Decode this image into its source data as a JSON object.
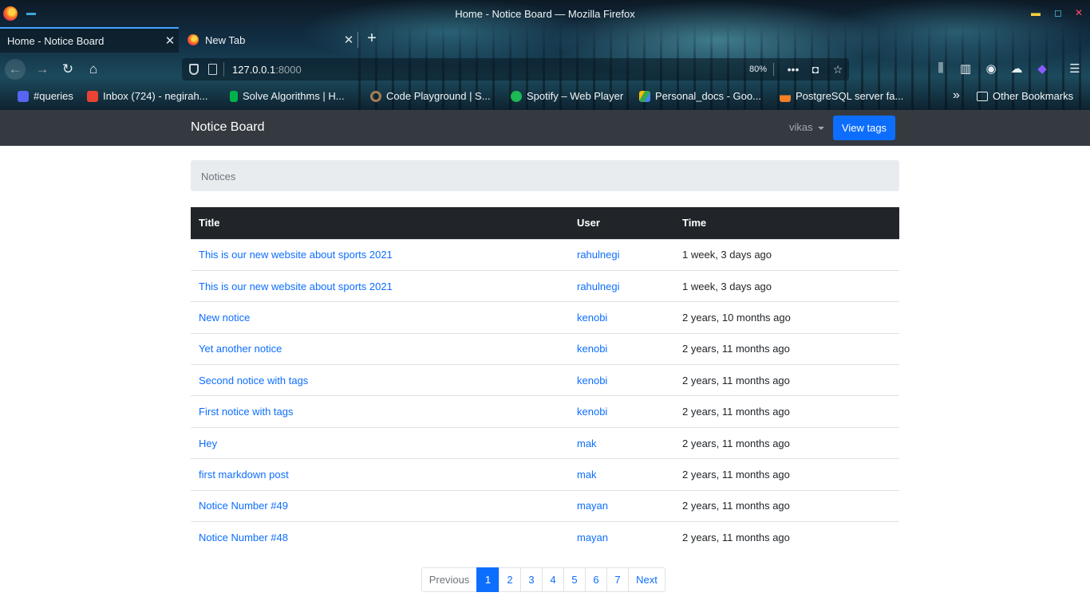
{
  "browser": {
    "window_title": "Home - Notice Board — Mozilla Firefox",
    "tabs": [
      {
        "label": "Home - Notice Board",
        "active": true
      },
      {
        "label": "New Tab",
        "active": false
      }
    ],
    "url_host": "127.0.0.1",
    "url_port": ":8000",
    "zoom": "80%",
    "bookmarks": [
      {
        "label": "#queries",
        "icon": "discord-icon"
      },
      {
        "label": "Inbox (724) - negirah...",
        "icon": "gmail-icon"
      },
      {
        "label": "Solve Algorithms | H...",
        "icon": "hackerrank-icon"
      },
      {
        "label": "Code Playground | S...",
        "icon": "sololearn-icon"
      },
      {
        "label": "Spotify – Web Player",
        "icon": "spotify-icon"
      },
      {
        "label": "Personal_docs - Goo...",
        "icon": "google-drive-icon"
      },
      {
        "label": "PostgreSQL server fa...",
        "icon": "stackoverflow-icon"
      }
    ],
    "other_bookmarks": "Other Bookmarks"
  },
  "site": {
    "brand": "Notice Board",
    "user": "vikas",
    "view_tags": "View tags",
    "breadcrumb": "Notices"
  },
  "table": {
    "headers": [
      "Title",
      "User",
      "Time"
    ],
    "rows": [
      {
        "title": "This is our new website about sports 2021",
        "user": "rahulnegi",
        "time": "1 week, 3 days ago"
      },
      {
        "title": "This is our new website about sports 2021",
        "user": "rahulnegi",
        "time": "1 week, 3 days ago"
      },
      {
        "title": "New notice",
        "user": "kenobi",
        "time": "2 years, 10 months ago"
      },
      {
        "title": "Yet another notice",
        "user": "kenobi",
        "time": "2 years, 11 months ago"
      },
      {
        "title": "Second notice with tags",
        "user": "kenobi",
        "time": "2 years, 11 months ago"
      },
      {
        "title": "First notice with tags",
        "user": "kenobi",
        "time": "2 years, 11 months ago"
      },
      {
        "title": "Hey",
        "user": "mak",
        "time": "2 years, 11 months ago"
      },
      {
        "title": "first markdown post",
        "user": "mak",
        "time": "2 years, 11 months ago"
      },
      {
        "title": "Notice Number #49",
        "user": "mayan",
        "time": "2 years, 11 months ago"
      },
      {
        "title": "Notice Number #48",
        "user": "mayan",
        "time": "2 years, 11 months ago"
      }
    ]
  },
  "pagination": {
    "previous": "Previous",
    "pages": [
      "1",
      "2",
      "3",
      "4",
      "5",
      "6",
      "7"
    ],
    "current": "1",
    "next": "Next"
  },
  "colors": {
    "navbar": "#343a40",
    "primary": "#0d6efd",
    "table_header": "#212529"
  }
}
